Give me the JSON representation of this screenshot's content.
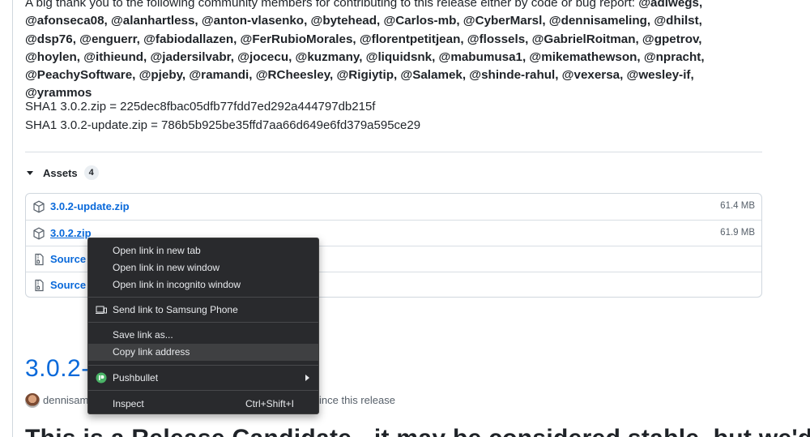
{
  "release_notes": {
    "thanks_intro": "A big thank you to the following community members for contributing to this release either by code or bug report: ",
    "contributors_line1_lead": "@adiwegs,",
    "contributors": "@afonseca08, @alanhartless, @anton-vlasenko, @bytehead, @Carlos-mb, @CyberMarsl, @dennisameling, @dhilst, @dsp76, @enguerr, @fabiodallazen, @FerRubioMorales, @florentpetitjean, @flossels, @GabrielRoitman, @gpetrov, @hoylen, @ithieund, @jadersilvabr, @jocecu, @kuzmany, @liquidsnk, @mabumusa1, @mikemathewson, @npracht, @PeachySoftware, @pjeby, @ramandi, @RCheesley, @Rigiytip, @Salamek, @shinde-rahul, @vexersa, @wesley-if, @yrammos",
    "sha_zip": "SHA1 3.0.2.zip = 225dec8fbac05dfb77fdd7ed292a444797db215f",
    "sha_update": "SHA1 3.0.2-update.zip = 786b5b925be35ffd7aa66d649e6fd379a595ce29"
  },
  "assets": {
    "label": "Assets",
    "count": "4",
    "items": [
      {
        "name": "3.0.2-update.zip",
        "size": "61.4 MB",
        "icon": "package-icon"
      },
      {
        "name": "3.0.2.zip",
        "size": "61.9 MB",
        "icon": "package-icon"
      },
      {
        "name": "Source c",
        "size": "",
        "icon": "file-zip-icon"
      },
      {
        "name": "Source c",
        "size": "",
        "icon": "file-zip-icon"
      }
    ]
  },
  "next_release": {
    "title": "3.0.2-r",
    "author": "dennisam",
    "since_text": "ince this release",
    "heading": "This is a Release Candidate - it may be considered stable, but we'd"
  },
  "context_menu": {
    "items": [
      {
        "label": "Open link in new tab"
      },
      {
        "label": "Open link in new window"
      },
      {
        "label": "Open link in incognito window"
      },
      {
        "label": "Send link to Samsung Phone",
        "icon": "devices-icon"
      },
      {
        "label": "Save link as..."
      },
      {
        "label": "Copy link address"
      },
      {
        "label": "Pushbullet",
        "icon": "pushbullet-icon"
      },
      {
        "label": "Inspect",
        "shortcut": "Ctrl+Shift+I"
      }
    ]
  },
  "colors": {
    "link": "#0969da",
    "menu_bg": "#292a2d",
    "menu_highlight": "#3f4042",
    "pushbullet": "#4ab367"
  }
}
